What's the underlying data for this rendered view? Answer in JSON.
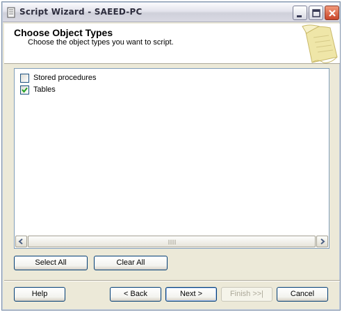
{
  "window": {
    "title": "Script Wizard - SAEED-PC"
  },
  "header": {
    "title": "Choose Object Types",
    "subtitle": "Choose the object types you want to script."
  },
  "object_types": [
    {
      "label": "Stored procedures",
      "checked": false
    },
    {
      "label": "Tables",
      "checked": true
    }
  ],
  "scrollbar": {
    "grip": "|||"
  },
  "selection_buttons": {
    "select_all": "Select All",
    "clear_all": "Clear All"
  },
  "footer": {
    "help": "Help",
    "back": "< Back",
    "next": "Next >",
    "finish": "Finish >>|",
    "cancel": "Cancel",
    "finish_enabled": false
  },
  "colors": {
    "window_bg": "#ece9d8",
    "button_border": "#003c74",
    "check_mark": "#21a121"
  }
}
